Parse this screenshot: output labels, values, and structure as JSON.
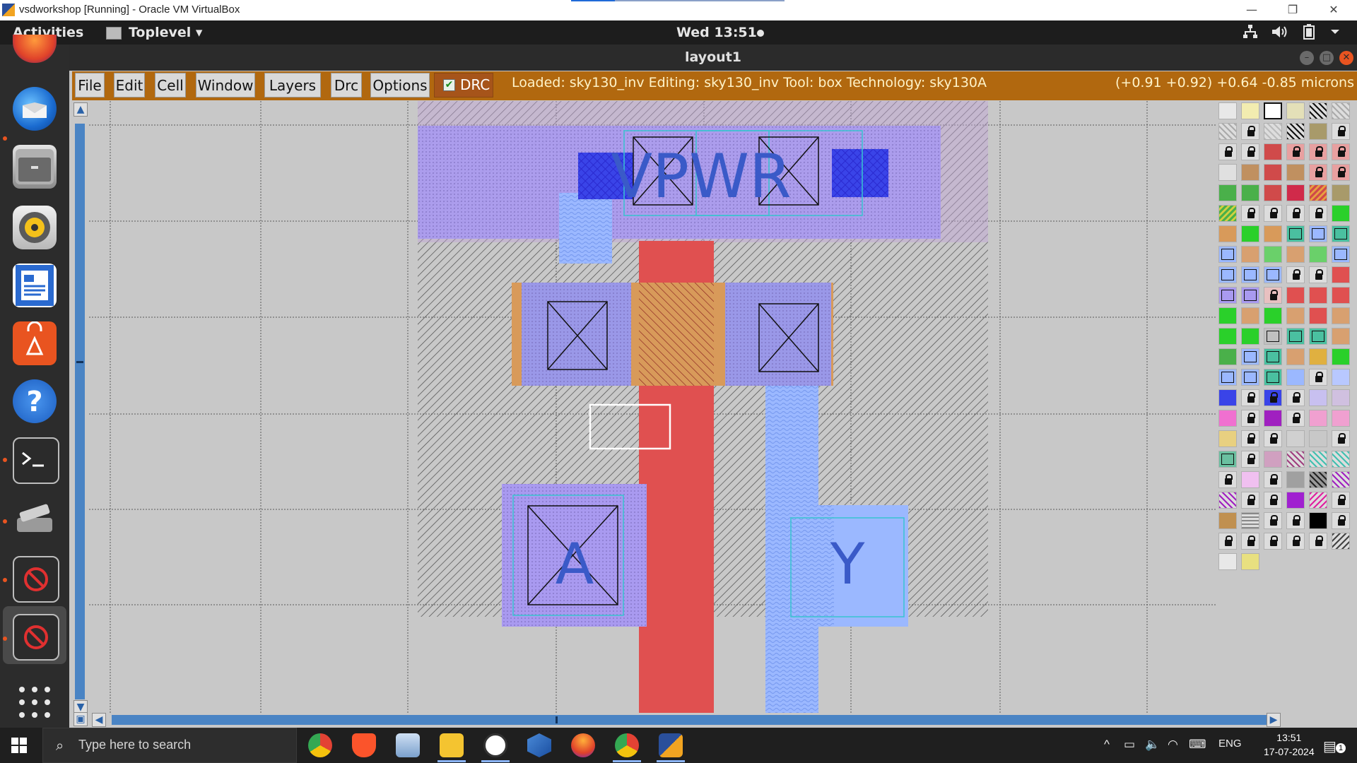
{
  "host_window": {
    "title": "vsdworkshop [Running] - Oracle VM VirtualBox",
    "minimize_glyph": "—",
    "restore_glyph": "❐",
    "close_glyph": "✕"
  },
  "gnome_bar": {
    "activities": "Activities",
    "app_menu": "Toplevel ▾",
    "clock": "Wed 13:51"
  },
  "dock": {
    "apps": [
      "firefox-icon",
      "thunderbird-icon",
      "files-icon",
      "rhythmbox-icon",
      "writer-icon",
      "software-icon",
      "help-icon",
      "terminal-icon",
      "scanner-icon",
      "blocked-app-icon",
      "blocked-app-icon",
      "show-apps-icon"
    ]
  },
  "magic_window": {
    "title": "layout1",
    "menu": [
      "File",
      "Edit",
      "Cell",
      "Window",
      "Layers",
      "Drc",
      "Options"
    ],
    "drc_label": "DRC",
    "drc_checked": true,
    "status": "Loaded: sky130_inv Editing: sky130_inv Tool: box  Technology: sky130A",
    "coords": "(+0.91 +0.92) +0.64 -0.85 microns"
  },
  "layout_labels": {
    "power": "VPWR",
    "input": "A",
    "output": "Y"
  },
  "colors": {
    "menubar": "#b1680f",
    "canvas_bg": "#c8c8c8",
    "metal1": "#8f8ff0",
    "poly": "#e05050",
    "ndiff": "#d89a5a",
    "locali": "#9bb8ff",
    "nwell_hatch": "#5a5a5a"
  },
  "taskbar": {
    "search_placeholder": "Type here to search",
    "language": "ENG",
    "time": "13:51",
    "date": "17-07-2024",
    "notification_count": "1"
  }
}
